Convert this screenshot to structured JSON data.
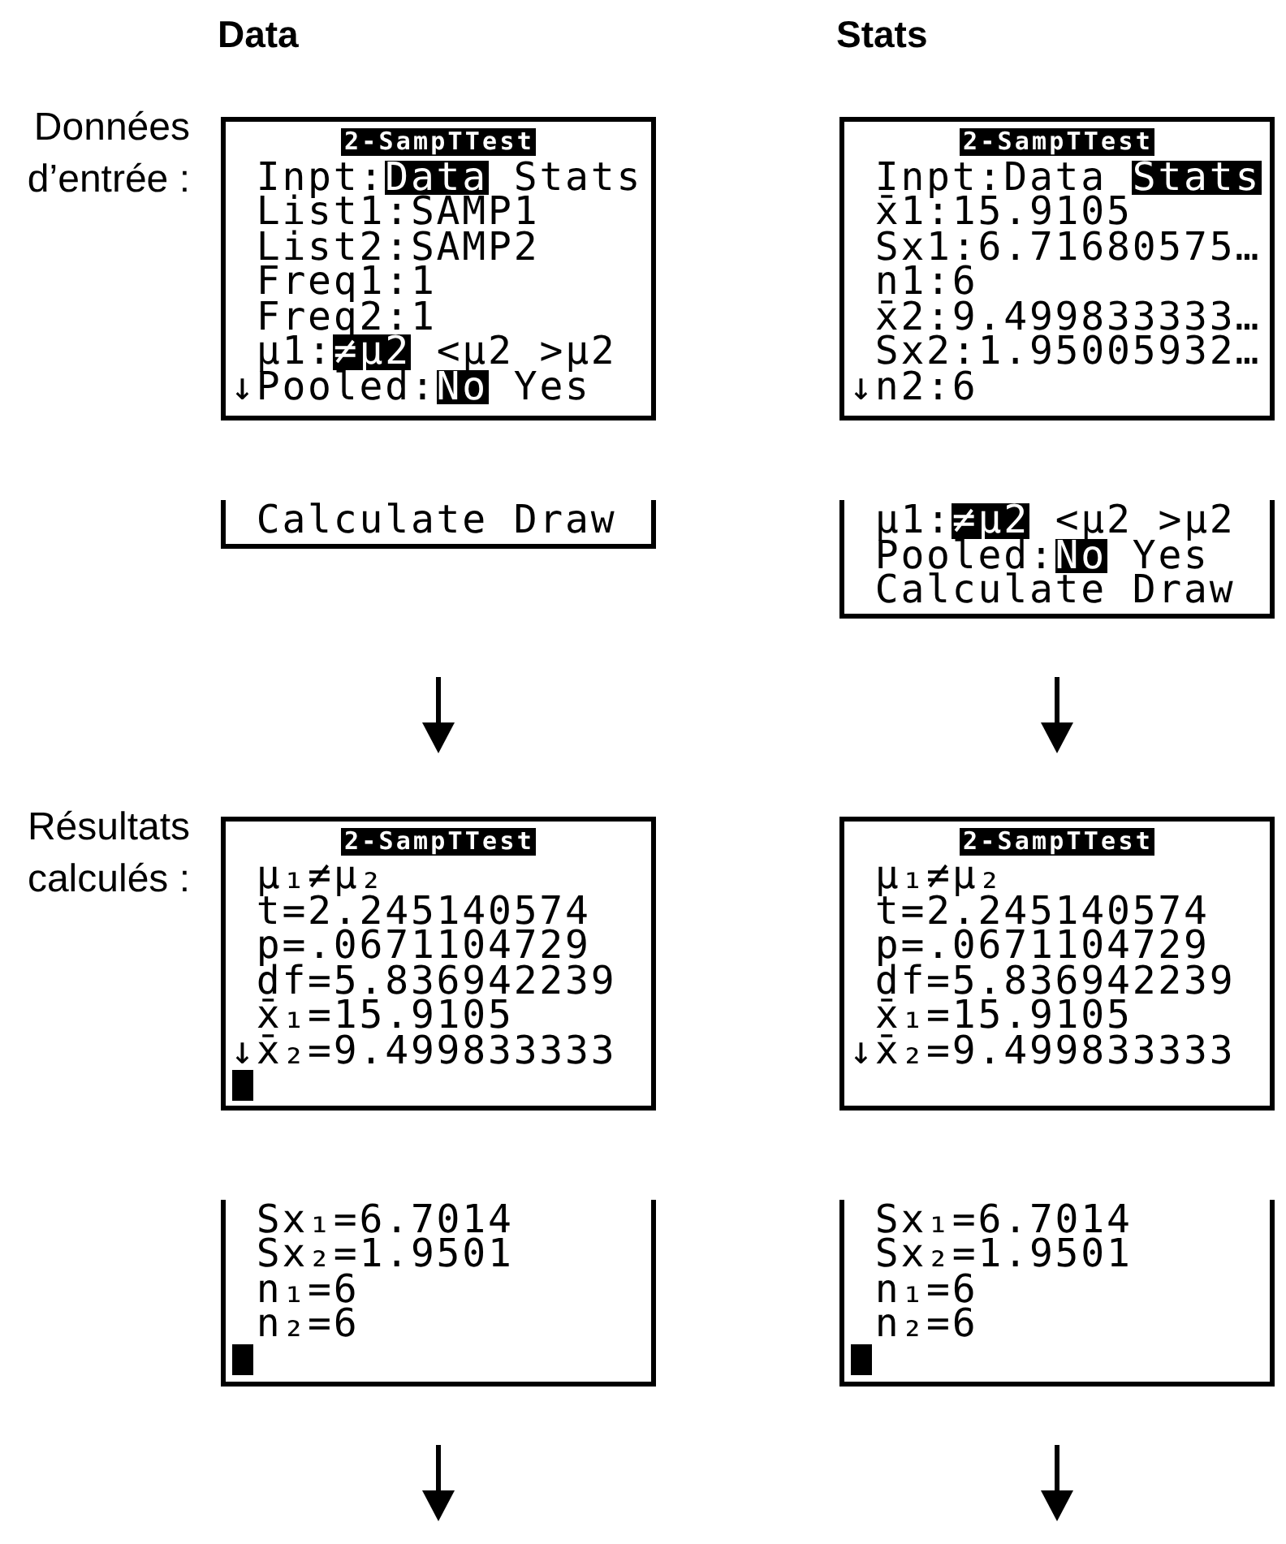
{
  "columns": [
    {
      "heading": "Data"
    },
    {
      "heading": "Stats"
    }
  ],
  "stages": [
    {
      "label": "Données d’entrée :",
      "screens": [
        {
          "title": "2-SampTTest",
          "cursor": false,
          "lines": [
            {
              "kind": "options",
              "label": "Inpt:",
              "options": [
                {
                  "text": "Data",
                  "selected": true
                },
                {
                  "text": "Stats",
                  "selected": false
                }
              ]
            },
            {
              "kind": "text",
              "text": "List1:SAMP1"
            },
            {
              "kind": "text",
              "text": "List2:SAMP2"
            },
            {
              "kind": "text",
              "text": "Freq1:1"
            },
            {
              "kind": "text",
              "text": "Freq2:1"
            },
            {
              "kind": "options",
              "label": "μ1:",
              "options": [
                {
                  "text": "≠μ2",
                  "selected": true
                },
                {
                  "text": "<μ2",
                  "selected": false
                },
                {
                  "text": ">μ2",
                  "selected": false
                }
              ]
            },
            {
              "kind": "options",
              "marker": "↓",
              "label": "Pooled:",
              "options": [
                {
                  "text": "No",
                  "selected": true
                },
                {
                  "text": "Yes",
                  "selected": false
                }
              ]
            }
          ]
        },
        {
          "title": "2-SampTTest",
          "cursor": false,
          "lines": [
            {
              "kind": "options",
              "label": "Inpt:",
              "options": [
                {
                  "text": "Data",
                  "selected": false
                },
                {
                  "text": "Stats",
                  "selected": true
                }
              ]
            },
            {
              "kind": "text",
              "text": "x̄1:15.9105"
            },
            {
              "kind": "text",
              "text": "Sx1:6.71680575…"
            },
            {
              "kind": "text",
              "text": "n1:6"
            },
            {
              "kind": "text",
              "text": "x̄2:9.499833333…"
            },
            {
              "kind": "text",
              "text": "Sx2:1.95005932…"
            },
            {
              "kind": "text",
              "marker": "↓",
              "text": "n2:6"
            }
          ]
        }
      ],
      "continuations": [
        {
          "cursor": false,
          "lines": [
            {
              "kind": "text",
              "text": "Calculate Draw"
            }
          ]
        },
        {
          "cursor": false,
          "lines": [
            {
              "kind": "options",
              "label": "μ1:",
              "options": [
                {
                  "text": "≠μ2",
                  "selected": true
                },
                {
                  "text": "<μ2",
                  "selected": false
                },
                {
                  "text": ">μ2",
                  "selected": false
                }
              ]
            },
            {
              "kind": "options",
              "label": "Pooled:",
              "options": [
                {
                  "text": "No",
                  "selected": true
                },
                {
                  "text": "Yes",
                  "selected": false
                }
              ]
            },
            {
              "kind": "text",
              "text": "Calculate Draw"
            }
          ]
        }
      ]
    },
    {
      "label": "Résultats calculés :",
      "screens": [
        {
          "title": "2-SampTTest",
          "cursor": true,
          "lines": [
            {
              "kind": "text",
              "text": "μ₁≠μ₂"
            },
            {
              "kind": "text",
              "text": "t=2.245140574"
            },
            {
              "kind": "text",
              "text": "p=.0671104729"
            },
            {
              "kind": "text",
              "text": "df=5.836942239"
            },
            {
              "kind": "text",
              "text": "x̄₁=15.9105"
            },
            {
              "kind": "text",
              "marker": "↓",
              "text": "x̄₂=9.499833333"
            }
          ]
        },
        {
          "title": "2-SampTTest",
          "cursor": false,
          "lines": [
            {
              "kind": "text",
              "text": "μ₁≠μ₂"
            },
            {
              "kind": "text",
              "text": "t=2.245140574"
            },
            {
              "kind": "text",
              "text": "p=.0671104729"
            },
            {
              "kind": "text",
              "text": "df=5.836942239"
            },
            {
              "kind": "text",
              "text": "x̄₁=15.9105"
            },
            {
              "kind": "text",
              "marker": "↓",
              "text": "x̄₂=9.499833333"
            }
          ]
        }
      ],
      "continuations": [
        {
          "cursor": true,
          "lines": [
            {
              "kind": "text",
              "text": "Sx₁=6.7014"
            },
            {
              "kind": "text",
              "text": "Sx₂=1.9501"
            },
            {
              "kind": "text",
              "text": "n₁=6"
            },
            {
              "kind": "text",
              "text": "n₂=6"
            }
          ]
        },
        {
          "cursor": true,
          "lines": [
            {
              "kind": "text",
              "text": "Sx₁=6.7014"
            },
            {
              "kind": "text",
              "text": "Sx₂=1.9501"
            },
            {
              "kind": "text",
              "text": "n₁=6"
            },
            {
              "kind": "text",
              "text": "n₂=6"
            }
          ]
        }
      ]
    }
  ]
}
